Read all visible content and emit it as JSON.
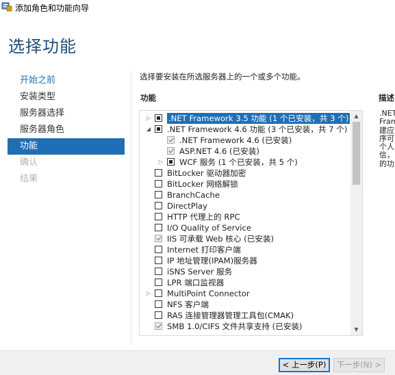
{
  "window": {
    "title": "添加角色和功能向导"
  },
  "page": {
    "title": "选择功能",
    "instruction": "选择要安装在所选服务器上的一个或多个功能。",
    "features_label": "功能",
    "description_label": "描述",
    "description_lines": [
      ".NET",
      "Fram",
      "建应",
      "序可",
      "个人",
      "信，",
      "的功"
    ]
  },
  "nav": {
    "items": [
      {
        "label": "开始之前",
        "state": "link"
      },
      {
        "label": "安装类型",
        "state": "normal"
      },
      {
        "label": "服务器选择",
        "state": "normal"
      },
      {
        "label": "服务器角色",
        "state": "normal"
      },
      {
        "label": "功能",
        "state": "active"
      },
      {
        "label": "确认",
        "state": "disabled"
      },
      {
        "label": "结果",
        "state": "disabled"
      }
    ]
  },
  "features": [
    {
      "label": ".NET Framework 3.5 功能 (1 个已安装，共 3 个)",
      "level": 0,
      "expander": "collapsed",
      "check": "partial",
      "selected": true
    },
    {
      "label": ".NET Framework 4.6 功能 (3 个已安装，共 7 个)",
      "level": 0,
      "expander": "expanded",
      "check": "partial",
      "selected": false
    },
    {
      "label": ".NET Framework 4.6 (已安装)",
      "level": 1,
      "expander": "none",
      "check": "checked-disabled",
      "selected": false
    },
    {
      "label": "ASP.NET 4.6 (已安装)",
      "level": 1,
      "expander": "none",
      "check": "checked-disabled",
      "selected": false
    },
    {
      "label": "WCF 服务 (1 个已安装，共 5 个)",
      "level": 1,
      "expander": "collapsed",
      "check": "partial",
      "selected": false
    },
    {
      "label": "BitLocker 驱动器加密",
      "level": 0,
      "expander": "none",
      "check": "unchecked",
      "selected": false
    },
    {
      "label": "BitLocker 网络解锁",
      "level": 0,
      "expander": "none",
      "check": "unchecked",
      "selected": false
    },
    {
      "label": "BranchCache",
      "level": 0,
      "expander": "none",
      "check": "unchecked",
      "selected": false
    },
    {
      "label": "DirectPlay",
      "level": 0,
      "expander": "none",
      "check": "unchecked",
      "selected": false
    },
    {
      "label": "HTTP 代理上的 RPC",
      "level": 0,
      "expander": "none",
      "check": "unchecked",
      "selected": false
    },
    {
      "label": "I/O Quality of Service",
      "level": 0,
      "expander": "none",
      "check": "unchecked",
      "selected": false
    },
    {
      "label": "IIS 可承载 Web 核心 (已安装)",
      "level": 0,
      "expander": "none",
      "check": "checked-disabled",
      "selected": false
    },
    {
      "label": "Internet 打印客户端",
      "level": 0,
      "expander": "none",
      "check": "unchecked",
      "selected": false
    },
    {
      "label": "IP 地址管理(IPAM)服务器",
      "level": 0,
      "expander": "none",
      "check": "unchecked",
      "selected": false
    },
    {
      "label": "iSNS Server 服务",
      "level": 0,
      "expander": "none",
      "check": "unchecked",
      "selected": false
    },
    {
      "label": "LPR 端口监视器",
      "level": 0,
      "expander": "none",
      "check": "unchecked",
      "selected": false
    },
    {
      "label": "MultiPoint Connector",
      "level": 0,
      "expander": "collapsed",
      "check": "unchecked",
      "selected": false
    },
    {
      "label": "NFS 客户端",
      "level": 0,
      "expander": "none",
      "check": "unchecked",
      "selected": false
    },
    {
      "label": "RAS 连接管理器管理工具包(CMAK)",
      "level": 0,
      "expander": "none",
      "check": "unchecked",
      "selected": false
    },
    {
      "label": "SMB 1.0/CIFS 文件共享支持 (已安装)",
      "level": 0,
      "expander": "none",
      "check": "checked-disabled",
      "selected": false
    }
  ],
  "buttons": {
    "prev": "< 上一步(P)",
    "next": "下一步(N) >"
  },
  "colors": {
    "accent": "#1f6fb6",
    "title": "#1f4e79"
  }
}
